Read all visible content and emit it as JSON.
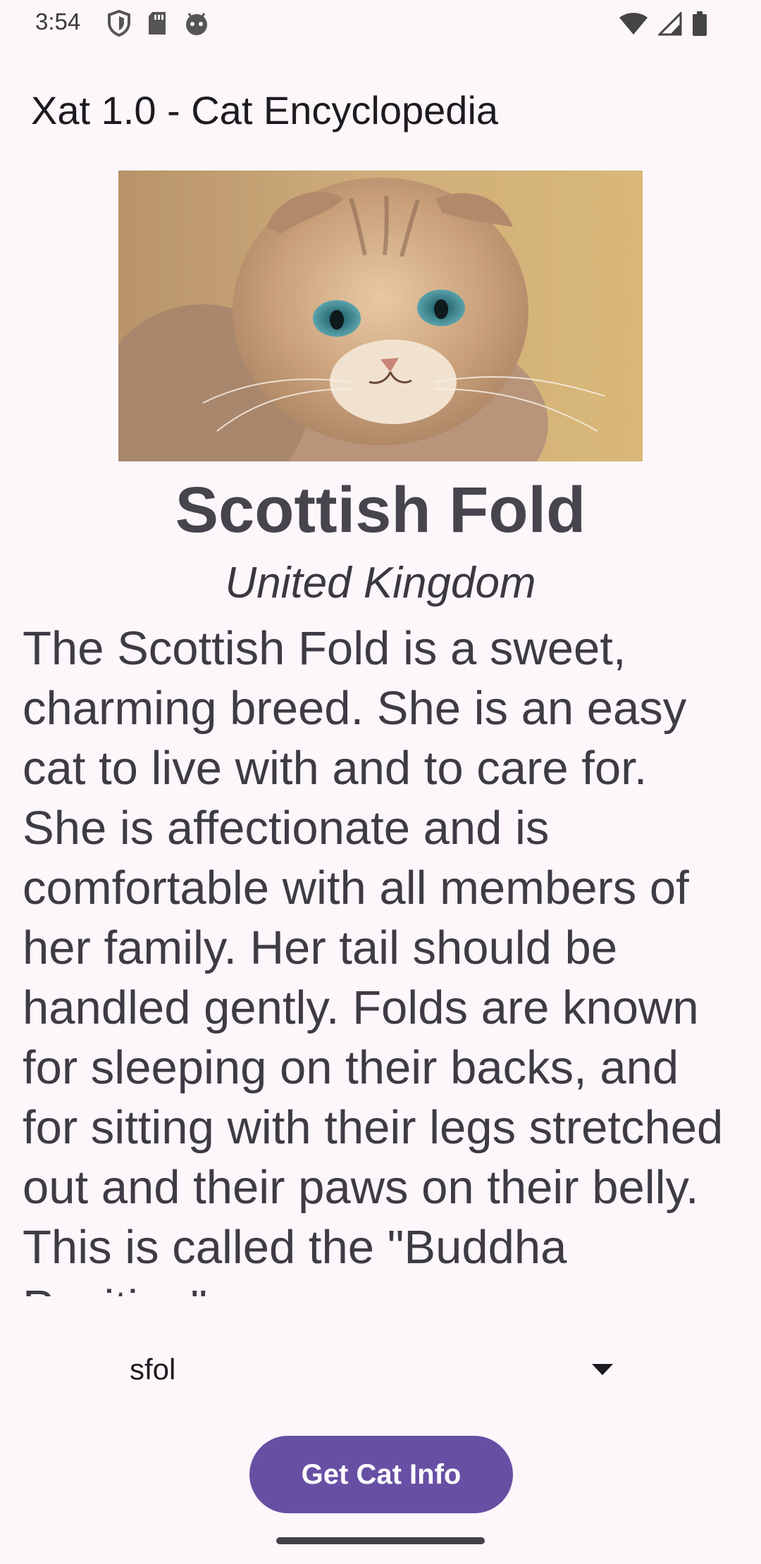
{
  "status_bar": {
    "time": "3:54",
    "left_icons": [
      "shield-icon",
      "sd-card-icon",
      "android-head-icon"
    ],
    "right_icons": [
      "wifi-icon",
      "cellular-signal-icon",
      "battery-icon"
    ]
  },
  "app": {
    "title": "Xat 1.0 - Cat Encyclopedia"
  },
  "breed": {
    "image_subject": "scottish-fold-cat-photo",
    "name": "Scottish Fold",
    "origin": "United Kingdom",
    "description": "The Scottish Fold is a sweet, charming breed. She is an easy cat to live with and to care for. She is affectionate and is comfortable with all members of her family. Her tail should be handled gently. Folds are known for sleeping on their backs, and for sitting with their legs stretched out and their paws on their belly. This is called the \"Buddha Position\"."
  },
  "selector": {
    "selected_value": "sfol"
  },
  "actions": {
    "get_info_label": "Get Cat Info"
  },
  "colors": {
    "background": "#fdf7fb",
    "primary": "#6750a4",
    "heading": "#46444c"
  }
}
